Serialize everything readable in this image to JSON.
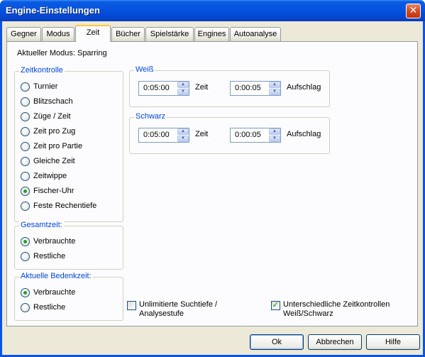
{
  "window": {
    "title": "Engine-Einstellungen",
    "close_symbol": "✕"
  },
  "tabs": [
    {
      "label": "Gegner"
    },
    {
      "label": "Modus"
    },
    {
      "label": "Zeit",
      "active": true
    },
    {
      "label": "Bücher"
    },
    {
      "label": "Spielstärke"
    },
    {
      "label": "Engines"
    },
    {
      "label": "Autoanalyse"
    }
  ],
  "current_mode": "Aktueller Modus: Sparring",
  "zeitkontrolle": {
    "legend": "Zeitkontrolle",
    "options": [
      {
        "label": "Turnier",
        "selected": false
      },
      {
        "label": "Blitzschach",
        "selected": false
      },
      {
        "label": "Züge / Zeit",
        "selected": false
      },
      {
        "label": "Zeit pro Zug",
        "selected": false
      },
      {
        "label": "Zeit pro Partie",
        "selected": false
      },
      {
        "label": "Gleiche Zeit",
        "selected": false
      },
      {
        "label": "Zeitwippe",
        "selected": false
      },
      {
        "label": "Fischer-Uhr",
        "selected": true
      },
      {
        "label": "Feste Rechentiefe",
        "selected": false
      }
    ]
  },
  "gesamtzeit": {
    "legend": "Gesamtzeit:",
    "options": [
      {
        "label": "Verbrauchte",
        "selected": true
      },
      {
        "label": "Restliche",
        "selected": false
      }
    ]
  },
  "bedenkzeit": {
    "legend": "Aktuelle Bedenkzeit:",
    "options": [
      {
        "label": "Verbrauchte",
        "selected": true
      },
      {
        "label": "Restliche",
        "selected": false
      }
    ]
  },
  "weiss": {
    "legend": "Weiß",
    "zeit_value": "0:05:00",
    "zeit_label": "Zeit",
    "aufschlag_value": "0:00:05",
    "aufschlag_label": "Aufschlag"
  },
  "schwarz": {
    "legend": "Schwarz",
    "zeit_value": "0:05:00",
    "zeit_label": "Zeit",
    "aufschlag_value": "0:00:05",
    "aufschlag_label": "Aufschlag"
  },
  "checkboxes": {
    "unlimited": {
      "line1": "Unlimitierte Suchtiefe /",
      "line2": "Analysestufe",
      "checked": false
    },
    "different": {
      "line1": "Unterschiedliche Zeitkontrollen",
      "line2": "Weiß/Schwarz",
      "checked": true
    }
  },
  "buttons": {
    "ok": "Ok",
    "cancel": "Abbrechen",
    "help": "Hilfe"
  },
  "icons": {
    "up_arrow": "▲",
    "down_arrow": "▼",
    "check": "✓"
  },
  "colors": {
    "title_bar": "#0553e0",
    "dialog_bg": "#ece9d8",
    "legend_text": "#0046d5",
    "radio_dot": "#21a121",
    "active_tab_accent": "#ffc83c"
  }
}
